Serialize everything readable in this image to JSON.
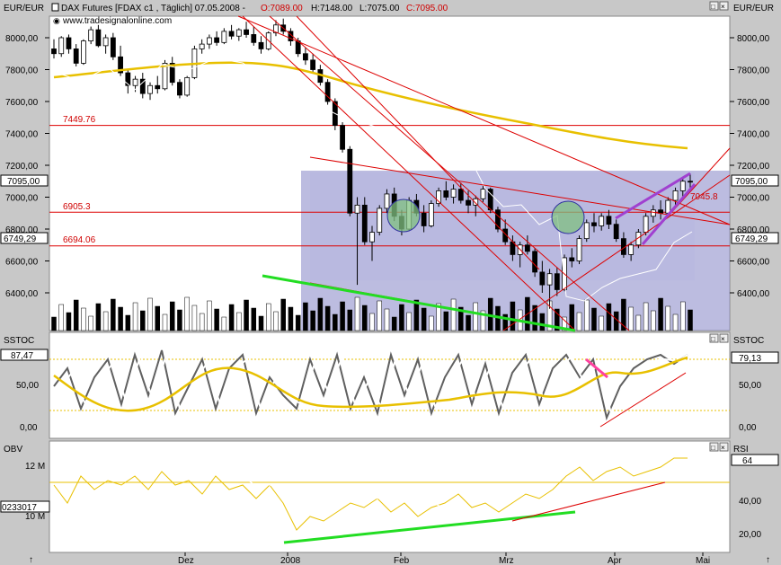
{
  "window": {
    "currency_left": "EUR/EUR",
    "currency_right": "EUR/EUR",
    "instrument": "DAX Futures [FDAX c1 , Täglich] 07.05.2008 -",
    "open": "O:7089.00",
    "high": "H:7148.00",
    "low": "L:7075.00",
    "close": "C:7095.00",
    "watermark": "www.tradesignalonline.com",
    "colors": {
      "background": "#c8c8c8",
      "panel": "#ffffff",
      "bear": "#000000",
      "bull": "#ffffff",
      "level": "#dd0000",
      "ma": "#e8c000",
      "trend_green": "#22dd22",
      "trend_purple": "#a040d0",
      "box": "#9090cc"
    }
  },
  "price_panel": {
    "y_ticks": [
      "8000,00",
      "7800,00",
      "7600,00",
      "7400,00",
      "7200,00",
      "7000,00",
      "6800,00",
      "6600,00",
      "6400,00"
    ],
    "right_ticks": [
      "8000,00",
      "7800,00",
      "7600,00",
      "7400,00",
      "7200,00",
      "7000,00",
      "6800,00",
      "6600,00",
      "6400,00"
    ],
    "last_price_left": "7095,00",
    "last_price_right": "7095,00",
    "marker_left": "6749,29",
    "marker_right": "6749,29",
    "levels": [
      {
        "label": "7449.76",
        "value": 7449.76
      },
      {
        "label": "6905.3",
        "value": 6905.3
      },
      {
        "label": "6694.06",
        "value": 6694.06
      }
    ],
    "target_label": "7045.8"
  },
  "stoch_panel": {
    "title_left": "SSTOC",
    "title_right": "SSTOC",
    "value_left": "87,47",
    "value_right": "79,13",
    "y_ticks": [
      "50,00",
      "0,00"
    ],
    "right_ticks": [
      "50,00",
      "0,00"
    ]
  },
  "obv_panel": {
    "title_left": "OBV",
    "title_right": "RSI",
    "obv_tick": "12 M",
    "obv_tick2": "10 M",
    "obv_value": "0233017",
    "rsi_value": "64",
    "rsi_ticks": [
      "40,00",
      "20,00"
    ]
  },
  "x_axis": {
    "labels": [
      "Dez",
      "2008",
      "Feb",
      "Mrz",
      "Apr",
      "Mai"
    ]
  },
  "chart_data": {
    "type": "candlestick",
    "title": "DAX Futures [FDAX c1 , Täglich] 07.05.2008",
    "ylim": [
      6200,
      8150
    ],
    "x_labels": [
      "Dez",
      "2008",
      "Feb",
      "Mrz",
      "Apr",
      "Mai"
    ],
    "ohlc": [
      [
        7930,
        7990,
        7870,
        7900
      ],
      [
        7900,
        8010,
        7880,
        8000
      ],
      [
        8000,
        8020,
        7900,
        7930
      ],
      [
        7930,
        7960,
        7820,
        7840
      ],
      [
        7840,
        7990,
        7830,
        7980
      ],
      [
        7980,
        8070,
        7960,
        8050
      ],
      [
        8050,
        8080,
        7940,
        7950
      ],
      [
        7950,
        8020,
        7900,
        8000
      ],
      [
        8000,
        8030,
        7860,
        7880
      ],
      [
        7880,
        7950,
        7760,
        7780
      ],
      [
        7780,
        7800,
        7650,
        7700
      ],
      [
        7700,
        7760,
        7660,
        7740
      ],
      [
        7740,
        7780,
        7620,
        7650
      ],
      [
        7650,
        7720,
        7610,
        7700
      ],
      [
        7700,
        7760,
        7650,
        7680
      ],
      [
        7680,
        7860,
        7670,
        7840
      ],
      [
        7840,
        7880,
        7700,
        7720
      ],
      [
        7720,
        7740,
        7620,
        7640
      ],
      [
        7640,
        7760,
        7630,
        7750
      ],
      [
        7750,
        7950,
        7740,
        7930
      ],
      [
        7930,
        7990,
        7900,
        7960
      ],
      [
        7960,
        8020,
        7930,
        8000
      ],
      [
        8000,
        8040,
        7950,
        7970
      ],
      [
        7970,
        8060,
        7960,
        8040
      ],
      [
        8040,
        8080,
        7990,
        8010
      ],
      [
        8010,
        8060,
        7980,
        8050
      ],
      [
        8050,
        8100,
        8000,
        8020
      ],
      [
        8020,
        8070,
        7950,
        7970
      ],
      [
        7970,
        8010,
        7900,
        7930
      ],
      [
        7930,
        8040,
        7920,
        8030
      ],
      [
        8030,
        8110,
        8010,
        8080
      ],
      [
        8080,
        8120,
        8020,
        8040
      ],
      [
        8040,
        8060,
        7950,
        7980
      ],
      [
        7980,
        8000,
        7880,
        7900
      ],
      [
        7900,
        7940,
        7830,
        7860
      ],
      [
        7860,
        7900,
        7780,
        7800
      ],
      [
        7800,
        7830,
        7700,
        7720
      ],
      [
        7720,
        7740,
        7580,
        7600
      ],
      [
        7600,
        7620,
        7420,
        7450
      ],
      [
        7450,
        7470,
        7280,
        7300
      ],
      [
        7300,
        7320,
        6880,
        6900
      ],
      [
        6900,
        7000,
        6450,
        6950
      ],
      [
        6950,
        7000,
        6700,
        6720
      ],
      [
        6720,
        6820,
        6600,
        6780
      ],
      [
        6780,
        6950,
        6760,
        6930
      ],
      [
        6930,
        7050,
        6900,
        7020
      ],
      [
        7020,
        7060,
        6850,
        6880
      ],
      [
        6880,
        6920,
        6760,
        6800
      ],
      [
        6800,
        7000,
        6790,
        6980
      ],
      [
        6980,
        7020,
        6880,
        6900
      ],
      [
        6900,
        6950,
        6780,
        6820
      ],
      [
        6820,
        6980,
        6810,
        6960
      ],
      [
        6960,
        7060,
        6940,
        7040
      ],
      [
        7040,
        7100,
        6980,
        7000
      ],
      [
        7000,
        7080,
        6960,
        7050
      ],
      [
        7050,
        7090,
        6960,
        6980
      ],
      [
        6980,
        7040,
        6900,
        6950
      ],
      [
        6950,
        7010,
        6880,
        6990
      ],
      [
        6990,
        7070,
        6970,
        7050
      ],
      [
        7050,
        7060,
        6900,
        6920
      ],
      [
        6920,
        6940,
        6780,
        6800
      ],
      [
        6800,
        6860,
        6700,
        6720
      ],
      [
        6720,
        6760,
        6600,
        6640
      ],
      [
        6640,
        6720,
        6560,
        6700
      ],
      [
        6700,
        6760,
        6640,
        6660
      ],
      [
        6660,
        6680,
        6500,
        6530
      ],
      [
        6530,
        6600,
        6400,
        6450
      ],
      [
        6450,
        6550,
        6300,
        6520
      ],
      [
        6520,
        6560,
        6380,
        6420
      ],
      [
        6420,
        6640,
        6410,
        6620
      ],
      [
        6620,
        6680,
        6560,
        6600
      ],
      [
        6600,
        6760,
        6580,
        6740
      ],
      [
        6740,
        6860,
        6720,
        6840
      ],
      [
        6840,
        6900,
        6780,
        6820
      ],
      [
        6820,
        6900,
        6790,
        6880
      ],
      [
        6880,
        6920,
        6800,
        6830
      ],
      [
        6830,
        6860,
        6720,
        6740
      ],
      [
        6740,
        6780,
        6620,
        6640
      ],
      [
        6640,
        6720,
        6600,
        6700
      ],
      [
        6700,
        6800,
        6680,
        6780
      ],
      [
        6780,
        6900,
        6760,
        6880
      ],
      [
        6880,
        6950,
        6840,
        6920
      ],
      [
        6920,
        6980,
        6860,
        6900
      ],
      [
        6900,
        7000,
        6880,
        6980
      ],
      [
        6980,
        7060,
        6940,
        7040
      ],
      [
        7040,
        7120,
        7000,
        7100
      ],
      [
        7100,
        7148,
        7060,
        7095
      ]
    ],
    "horizontal_levels": [
      7449.76,
      6905.3,
      6694.06
    ]
  }
}
